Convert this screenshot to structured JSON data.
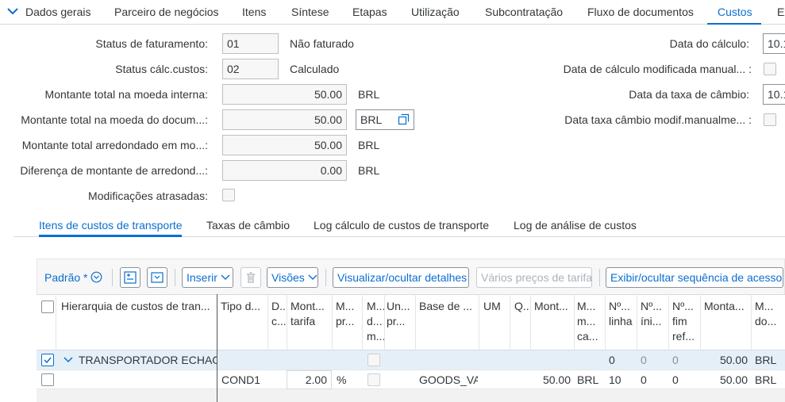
{
  "tabs": [
    "Dados gerais",
    "Parceiro de negócios",
    "Itens",
    "Síntese",
    "Etapas",
    "Utilização",
    "Subcontratação",
    "Fluxo de documentos",
    "Custos",
    "Ex"
  ],
  "active_tab": "Custos",
  "form": {
    "status_faturamento": {
      "label": "Status de faturamento:",
      "code": "01",
      "text": "Não faturado"
    },
    "status_calc": {
      "label": "Status cálc.custos:",
      "code": "02",
      "text": "Calculado"
    },
    "montante_interna": {
      "label": "Montante total na moeda interna:",
      "value": "50.00",
      "currency": "BRL"
    },
    "montante_documento": {
      "label": "Montante total na moeda do docum...:",
      "value": "50.00",
      "currency": "BRL"
    },
    "montante_arredondado": {
      "label": "Montante total arredondado em mo...:",
      "value": "50.00",
      "currency": "BRL"
    },
    "diferenca": {
      "label": "Diferença de montante de arredond...:",
      "value": "0.00",
      "currency": "BRL"
    },
    "modificacoes": {
      "label": "Modificações atrasadas:"
    },
    "data_calculo": {
      "label": "Data do cálculo:",
      "value": "10.1"
    },
    "data_calc_mod": {
      "label": "Data de cálculo modificada manual... :"
    },
    "data_taxa": {
      "label": "Data da taxa de câmbio:",
      "value": "10.1"
    },
    "data_taxa_mod": {
      "label": "Data taxa câmbio modif.manualme... :"
    }
  },
  "subtabs": [
    "Itens de custos de transporte",
    "Taxas de câmbio",
    "Log cálculo de custos de transporte",
    "Log de análise de custos"
  ],
  "toolbar": {
    "variant": "Padrão *",
    "insert": "Inserir",
    "views": "Visões",
    "toggle_details": "Visualizar/ocultar detalhes",
    "rates": "Vários preços de tarifa",
    "access_seq": "Exibir/ocultar sequência de acesso"
  },
  "columns": [
    "Hierarquia de custos de tran...",
    "Tipo d...",
    "D...\nc...",
    "Mont...\ntarifa",
    "M...\npr...",
    "M...\nd...\nm...",
    "Un...\npr...",
    "Base de ...",
    "UM",
    "Q...",
    "Mont...",
    "M...\nm...\nca...",
    "Nº...\nlinha",
    "Nº...\níni...",
    "Nº...\nfim\nref...",
    "Monta...",
    "M...\ndo..."
  ],
  "rows": [
    {
      "hierarchy": "TRANSPORTADOR ECHAGA",
      "line_no": "0",
      "start_no": "0",
      "end_ref": "0",
      "amount": "50.00",
      "currency": "BRL"
    },
    {
      "type": "COND1",
      "rate": "2.00",
      "rate_unit": "%",
      "base": "GOODS_VA",
      "base_amount": "50.00",
      "base_currency": "BRL",
      "line_no": "10",
      "start_no": "0",
      "end_ref": "0",
      "amount": "50.00",
      "currency": "BRL"
    }
  ]
}
